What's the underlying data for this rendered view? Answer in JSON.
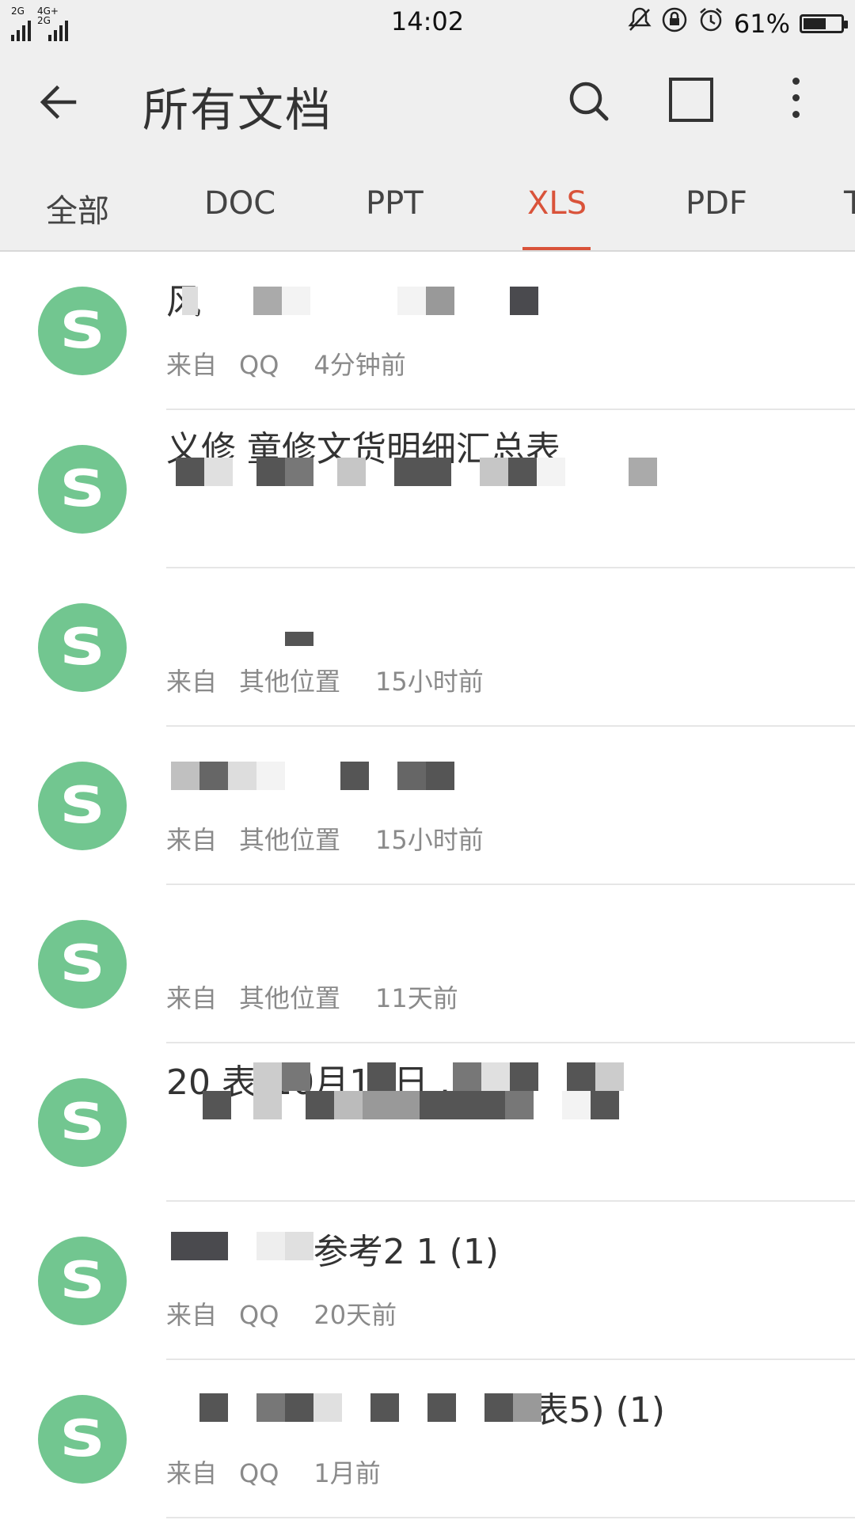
{
  "status_bar": {
    "network_1": "2G",
    "network_2": "4G+ 2G",
    "time": "14:02",
    "battery_percent": "61%",
    "battery_level": 0.61
  },
  "app_bar": {
    "title": "所有文档"
  },
  "tabs": [
    {
      "label": "全部"
    },
    {
      "label": "DOC"
    },
    {
      "label": "PPT"
    },
    {
      "label": "XLS"
    },
    {
      "label": "PDF"
    },
    {
      "label": "T"
    }
  ],
  "active_tab": "XLS",
  "files": [
    {
      "name": "风",
      "source": "来自",
      "app": "QQ",
      "time": "4分钟前"
    },
    {
      "name": "义修 童修文货明细汇总表",
      "source": "",
      "app": "",
      "time": ""
    },
    {
      "name": "",
      "source": "来自",
      "app": "其他位置",
      "time": "15小时前"
    },
    {
      "name": "",
      "source": "来自",
      "app": "其他位置",
      "time": "15小时前"
    },
    {
      "name": "",
      "source": "来自",
      "app": "其他位置",
      "time": "11天前"
    },
    {
      "name": "20 表(10月12日 ...",
      "source": "",
      "app": "",
      "time": ""
    },
    {
      "name": "参考2 1 (1)",
      "source": "来自",
      "app": "QQ",
      "time": "20天前"
    },
    {
      "name": "表5) (1)",
      "source": "来自",
      "app": "QQ",
      "time": "1月前"
    }
  ],
  "avatar_letter": "S",
  "colors": {
    "accent": "#d9533a",
    "avatar_green": "#72c690"
  }
}
